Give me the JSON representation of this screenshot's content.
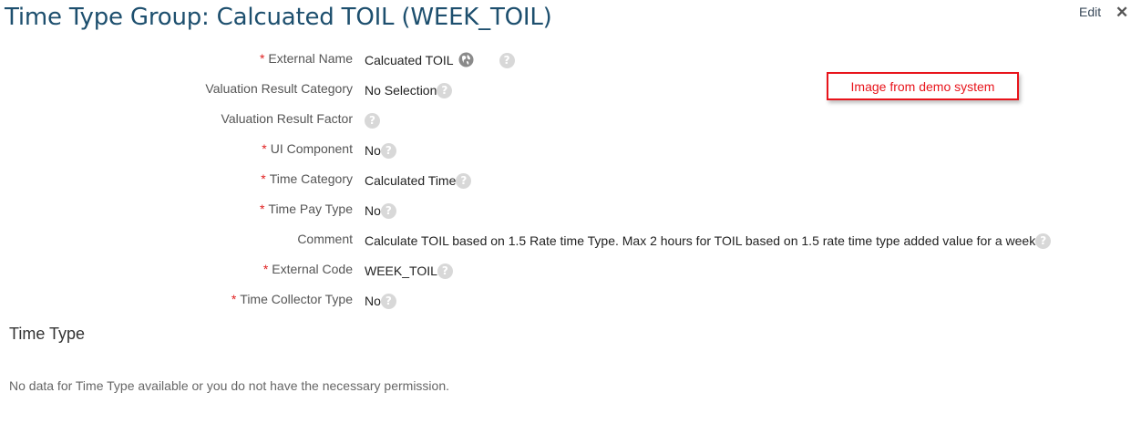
{
  "page": {
    "title": "Time Type Group: Calcuated TOIL (WEEK_TOIL)",
    "edit_label": "Edit",
    "close_glyph": "✕",
    "demo_note": "Image from demo system"
  },
  "fields": [
    {
      "label": "External Name",
      "required": true,
      "value": "Calcuated TOIL"
    },
    {
      "label": "Valuation Result Category",
      "required": false,
      "value": "No Selection"
    },
    {
      "label": "Valuation Result Factor",
      "required": false,
      "value": ""
    },
    {
      "label": "UI Component",
      "required": true,
      "value": "No"
    },
    {
      "label": "Time Category",
      "required": true,
      "value": "Calculated Time"
    },
    {
      "label": "Time Pay Type",
      "required": true,
      "value": "No"
    },
    {
      "label": "Comment",
      "required": false,
      "value": "Calculate TOIL based on 1.5 Rate time Type. Max 2 hours for TOIL based on 1.5 rate time type added value for a week"
    },
    {
      "label": "External Code",
      "required": true,
      "value": "WEEK_TOIL"
    },
    {
      "label": "Time Collector Type",
      "required": true,
      "value": "No"
    }
  ],
  "required_marker": "*",
  "help_glyph": "?",
  "icons": {
    "translation": "globe-icon",
    "help": "help-icon",
    "close": "close-icon"
  },
  "section": {
    "title": "Time Type",
    "empty_message": "No data for Time Type available or you do not have the necessary permission."
  },
  "colors": {
    "title": "#1d4f6e",
    "required": "#e02020",
    "demo_border": "#e8141b"
  }
}
